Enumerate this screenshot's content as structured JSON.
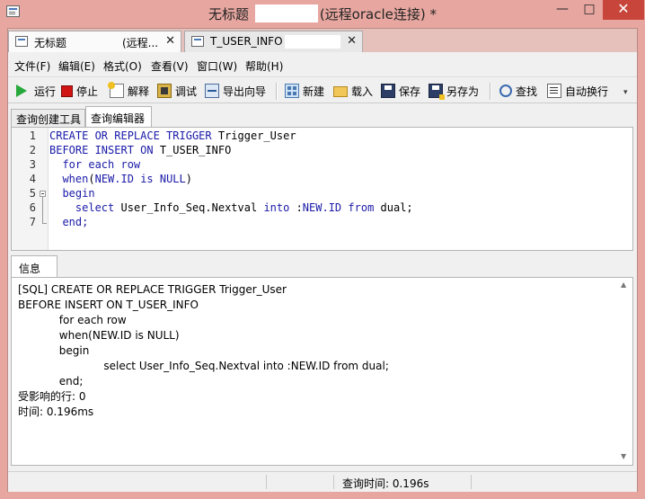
{
  "window": {
    "title_prefix": "无标题",
    "title_suffix": "(远程oracle连接) *",
    "minimize": "—",
    "maximize": "□",
    "close": "✕"
  },
  "doc_tabs": [
    {
      "label": "无标题",
      "suffix": "(远程...",
      "close": "✕",
      "icon": "query-doc-icon"
    },
    {
      "label": "T_USER_INFO",
      "close": "✕",
      "icon": "table-doc-icon"
    }
  ],
  "menu": {
    "items": [
      "文件(F)",
      "编辑(E)",
      "格式(O)",
      "查看(V)",
      "窗口(W)",
      "帮助(H)"
    ]
  },
  "toolbar": {
    "run": "运行",
    "stop": "停止",
    "explain": "解释",
    "debug": "调试",
    "export_wizard": "导出向导",
    "new": "新建",
    "load": "载入",
    "save": "保存",
    "save_as": "另存为",
    "find": "查找",
    "word_wrap": "自动换行"
  },
  "sub_tabs": [
    "查询创建工具",
    "查询编辑器"
  ],
  "editor": {
    "lines": [
      {
        "num": "1",
        "parts": [
          [
            "CREATE OR REPLACE TRIGGER",
            "kw"
          ],
          [
            " Trigger_User",
            ""
          ]
        ]
      },
      {
        "num": "2",
        "parts": [
          [
            "BEFORE INSERT ON",
            "kw"
          ],
          [
            " T_USER_INFO",
            ""
          ]
        ]
      },
      {
        "num": "3",
        "parts": [
          [
            "  for each row",
            "kw"
          ]
        ]
      },
      {
        "num": "4",
        "parts": [
          [
            "  when",
            "kw"
          ],
          [
            "(",
            ""
          ],
          [
            "NEW.ID",
            "kw"
          ],
          [
            " ",
            ""
          ],
          [
            "is NULL",
            "kw"
          ],
          [
            ")",
            ""
          ]
        ]
      },
      {
        "num": "5",
        "parts": [
          [
            "  begin",
            "kw"
          ]
        ]
      },
      {
        "num": "6",
        "parts": [
          [
            "    ",
            ""
          ],
          [
            "select",
            "kw"
          ],
          [
            " User_Info_Seq.Nextval ",
            ""
          ],
          [
            "into",
            "kw"
          ],
          [
            " :",
            ""
          ],
          [
            "NEW.ID",
            "kw"
          ],
          [
            " ",
            ""
          ],
          [
            "from",
            "kw"
          ],
          [
            " dual;",
            ""
          ]
        ]
      },
      {
        "num": "7",
        "parts": [
          [
            "  end;",
            "kw"
          ]
        ]
      }
    ]
  },
  "info": {
    "tab_label": "信息",
    "lines": [
      "[SQL] CREATE OR REPLACE TRIGGER Trigger_User",
      "BEFORE INSERT ON T_USER_INFO",
      "            for each row",
      "            when(NEW.ID is NULL)",
      "            begin",
      "                         select User_Info_Seq.Nextval into :NEW.ID from dual;",
      "            end;",
      "受影响的行: 0",
      "时间: 0.196ms"
    ]
  },
  "status": {
    "query_time": "查询时间: 0.196s"
  }
}
